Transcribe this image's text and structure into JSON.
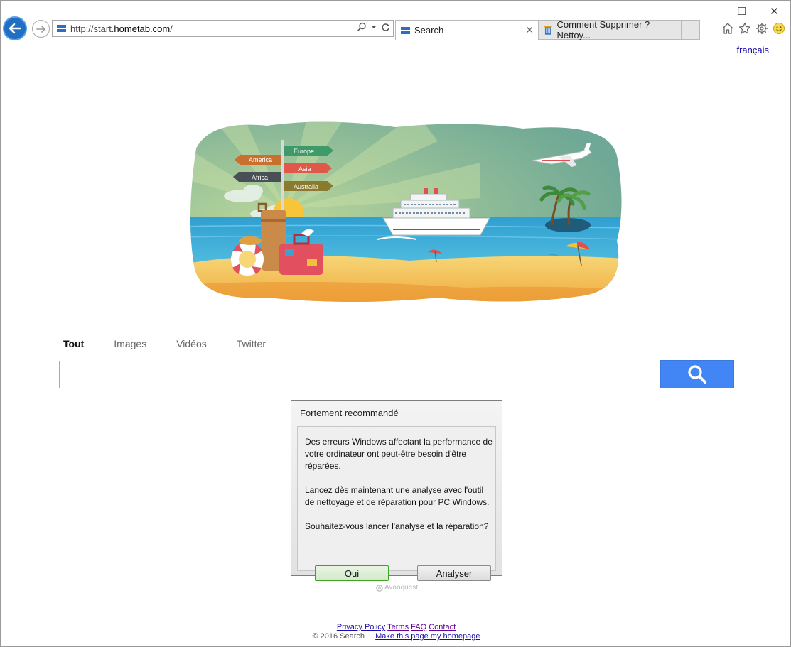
{
  "browser": {
    "url_prefix": "http://start.",
    "url_domain": "hometab.com",
    "url_suffix": "/",
    "tabs": [
      {
        "title": "Search",
        "active": true
      },
      {
        "title": "Comment Supprimer ? Nettoy...",
        "active": false
      }
    ],
    "window_controls": {
      "minimize": "—",
      "maximize": "☐",
      "close": "✕"
    },
    "tab_close": "✕"
  },
  "header": {
    "language_link": "français"
  },
  "search": {
    "tabs": [
      "Tout",
      "Images",
      "Vidéos",
      "Twitter"
    ],
    "selected_tab": "Tout",
    "input_value": "",
    "button_color": "#4285f4"
  },
  "hero": {
    "signposts": [
      "America",
      "Europe",
      "Asia",
      "Africa",
      "Australia"
    ]
  },
  "dialog": {
    "title": "Fortement recommandé",
    "paragraph1": "Des erreurs Windows affectant la performance de votre ordinateur ont peut-être besoin d'être réparées.",
    "paragraph2": "Lancez dès maintenant une analyse avec l'outil de nettoyage et de réparation pour PC Windows.",
    "question": "Souhaitez-vous lancer l'analyse et la réparation?",
    "yes_button": "Oui",
    "analyze_button": "Analyser",
    "brand": "Avanquest"
  },
  "footer": {
    "privacy": "Privacy Policy",
    "terms": "Terms",
    "faq": "FAQ",
    "contact": "Contact",
    "copyright": "© 2016 Search",
    "separator": "|",
    "homepage": "Make this page my homepage"
  }
}
